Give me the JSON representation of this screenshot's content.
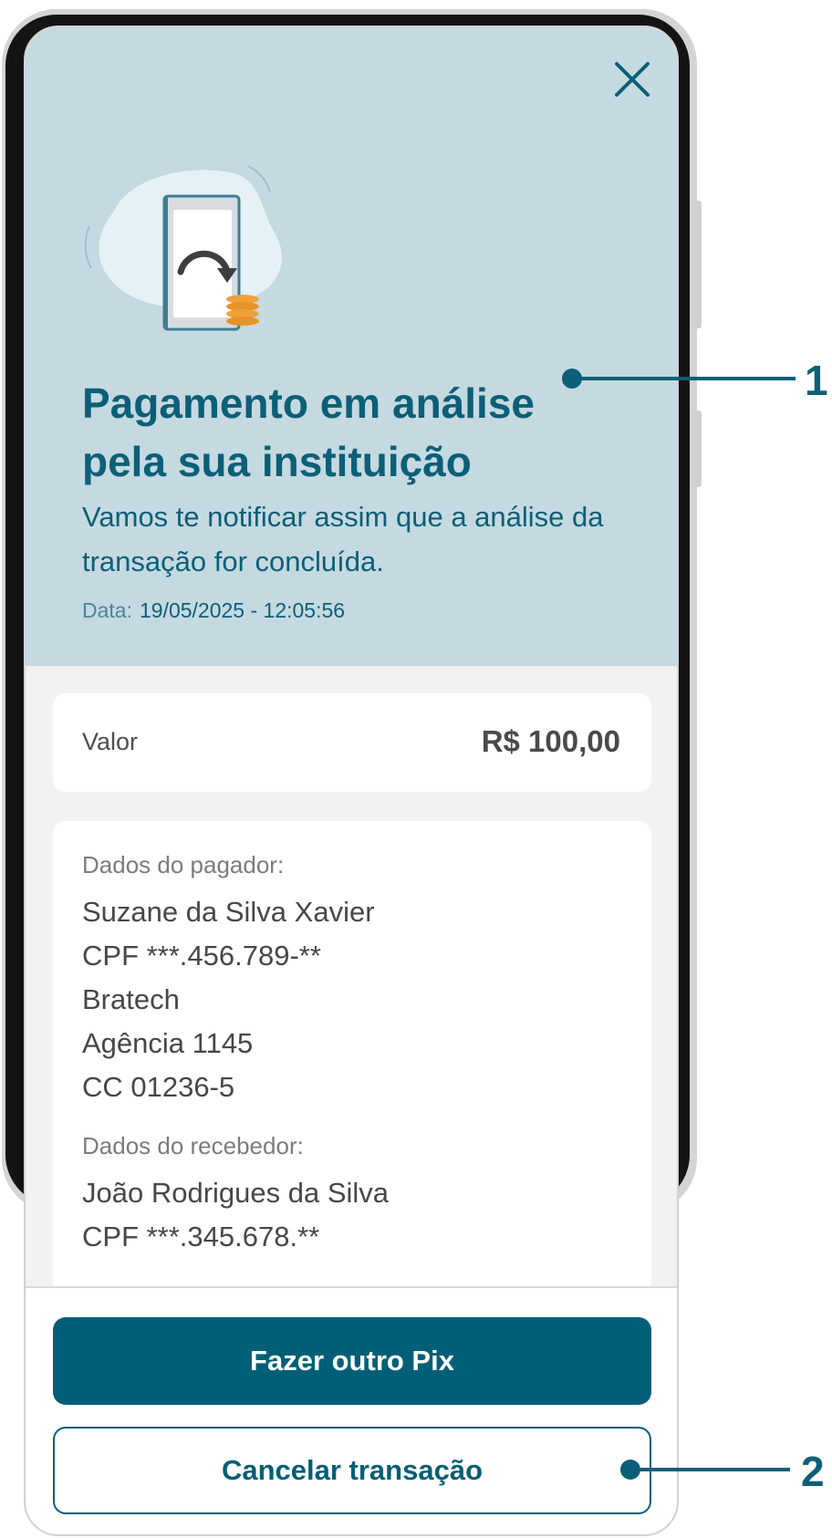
{
  "header": {
    "close_icon": "close-icon",
    "illustration_icon": "phone-transfer-coins-icon",
    "title": "Pagamento em análise pela sua instituição",
    "subtitle": "Vamos te notificar assim que a análise da transação for concluída.",
    "date_label": "Data:",
    "date_value": "19/05/2025 - 12:05:56"
  },
  "amount": {
    "label": "Valor",
    "value": "R$ 100,00"
  },
  "payer": {
    "label": "Dados do pagador:",
    "lines": [
      "Suzane da Silva Xavier",
      "CPF ***.456.789-**",
      "Bratech",
      "Agência 1145",
      "CC 01236-5"
    ]
  },
  "receiver": {
    "label": "Dados do recebedor:",
    "lines": [
      "João Rodrigues da Silva",
      "CPF ***.345.678.**"
    ]
  },
  "actions": {
    "primary": "Fazer outro Pix",
    "secondary": "Cancelar transação"
  },
  "callouts": [
    "1",
    "2"
  ],
  "colors": {
    "brand": "#005f77",
    "hero_background": "#c5d9e1",
    "coins": "#f0a13a"
  }
}
